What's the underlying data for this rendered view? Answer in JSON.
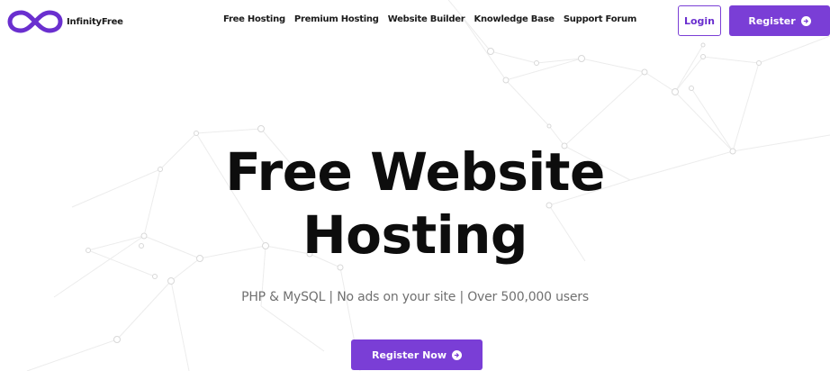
{
  "brand": {
    "name": "InfinityFree",
    "logo_icon": "infinity-logo-icon",
    "color": "#6a2fcf"
  },
  "nav": {
    "items": [
      {
        "label": "Free Hosting"
      },
      {
        "label": "Premium Hosting"
      },
      {
        "label": "Website Builder"
      },
      {
        "label": "Knowledge Base"
      },
      {
        "label": "Support Forum"
      }
    ]
  },
  "header_actions": {
    "login_label": "Login",
    "register_label": "Register",
    "register_icon": "arrow-right-circle-icon"
  },
  "hero": {
    "title_line1": "Free Website",
    "title_line2": "Hosting",
    "subtitle": "PHP & MySQL | No ads on your site | Over 500,000 users",
    "cta_label": "Register Now",
    "cta_icon": "arrow-right-circle-icon"
  },
  "theme": {
    "accent": "#7a3ed6",
    "text": "#0d0d0d",
    "muted": "#707070",
    "network_lines": "#e6e6e6"
  }
}
